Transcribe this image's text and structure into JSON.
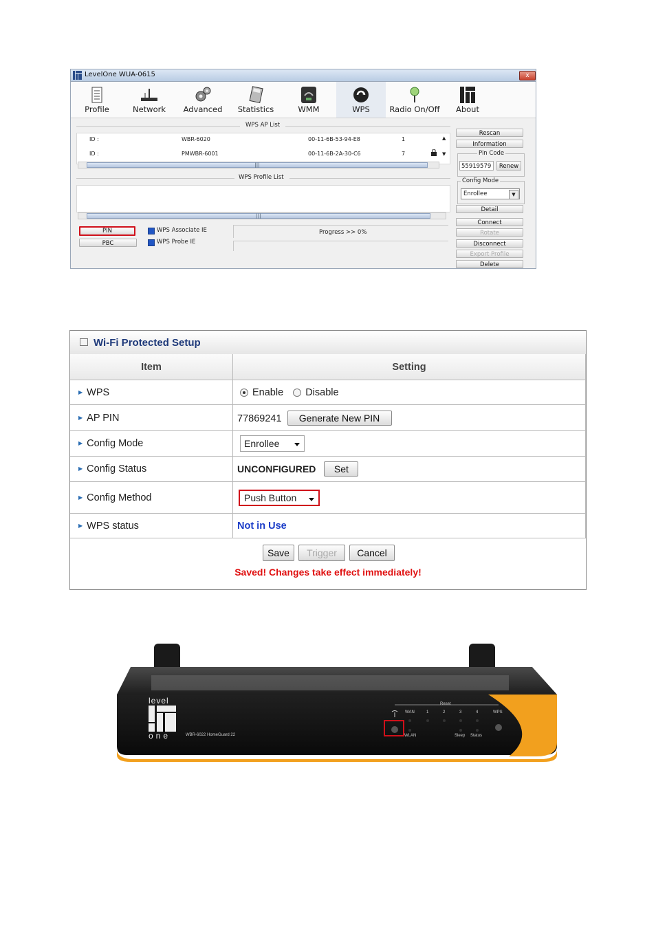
{
  "app": {
    "window_title": "LevelOne WUA-0615",
    "close_label": "x",
    "toolbar": [
      "Profile",
      "Network",
      "Advanced",
      "Statistics",
      "WMM",
      "WPS",
      "Radio On/Off",
      "About"
    ],
    "ap_list_title": "WPS AP List",
    "ap_rows": [
      {
        "id_label": "ID :",
        "name": "WBR-6020",
        "mac": "00-11-6B-53-94-E8",
        "channel": "1"
      },
      {
        "id_label": "ID :",
        "name": "PMWBR-6001",
        "mac": "00-11-6B-2A-30-C6",
        "channel": "7"
      }
    ],
    "profile_list_title": "WPS Profile List",
    "pin_button": "PIN",
    "pbc_button": "PBC",
    "assoc_ie": "WPS Associate IE",
    "probe_ie": "WPS Probe IE",
    "progress_text": "Progress >> 0%",
    "side": {
      "rescan": "Rescan",
      "information": "Information",
      "pin_code_label": "Pin Code",
      "pin_code_value": "55919579",
      "renew": "Renew",
      "config_mode_label": "Config Mode",
      "config_mode_value": "Enrollee",
      "detail": "Detail",
      "connect": "Connect",
      "rotate": "Rotate",
      "disconnect": "Disconnect",
      "export_profile": "Export Profile",
      "delete": "Delete"
    }
  },
  "wps": {
    "title": "Wi-Fi Protected Setup",
    "col_item": "Item",
    "col_setting": "Setting",
    "rows": {
      "wps": {
        "label": "WPS",
        "enable": "Enable",
        "disable": "Disable"
      },
      "ap_pin": {
        "label": "AP PIN",
        "value": "77869241",
        "button": "Generate New PIN"
      },
      "config_mode": {
        "label": "Config Mode",
        "value": "Enrollee"
      },
      "config_status": {
        "label": "Config Status",
        "value": "UNCONFIGURED",
        "button": "Set"
      },
      "config_method": {
        "label": "Config Method",
        "value": "Push Button"
      },
      "wps_status": {
        "label": "WPS status",
        "value": "Not in Use"
      }
    },
    "save": "Save",
    "trigger": "Trigger",
    "cancel": "Cancel",
    "message": "Saved! Changes take effect immediately!"
  },
  "router": {
    "brand_top": "level",
    "brand_bottom": "one",
    "model": "WBR-6022 HomeGuard 22",
    "reset": "Reset",
    "wan": "WAN",
    "ports": [
      "1",
      "2",
      "3",
      "4"
    ],
    "wps": "WPS",
    "wlan": "WLAN",
    "sleep": "Sleep",
    "status": "Status"
  },
  "colors": {
    "highlight": "#d0101a",
    "link_blue": "#1a3cc8",
    "message_red": "#e01010",
    "router_orange": "#f2a01e"
  }
}
